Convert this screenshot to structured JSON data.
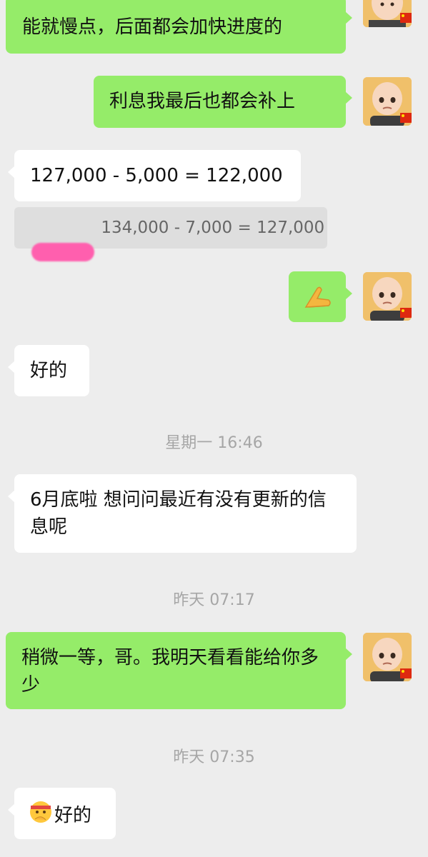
{
  "messages": [
    {
      "text": "能就慢点，后面都会加快进度的"
    },
    {
      "text": "利息我最后也都会补上"
    },
    {
      "text": "127,000 - 5,000 = 122,000"
    },
    {
      "text": "好的"
    },
    {
      "text": "6月底啦  想问问最近有没有更新的信息呢"
    },
    {
      "text": "稍微一等，哥。我明天看看能给你多少"
    },
    {
      "text": "好的"
    }
  ],
  "quote": {
    "text": "134,000 - 7,000 = 127,000"
  },
  "timestamps": [
    "星期一 16:46",
    "昨天 07:17",
    "昨天 07:35"
  ],
  "icons": {
    "avatar": "cartoon-boy-avatar",
    "flag": "china-flag",
    "gesture": "hand-gesture-emoji",
    "emoji": "thinking-face-emoji"
  },
  "colors": {
    "background": "#ededed",
    "outgoing_bubble": "#95ec69",
    "incoming_bubble": "#ffffff",
    "quote_background": "#dedede",
    "redaction": "#ff5fae"
  }
}
